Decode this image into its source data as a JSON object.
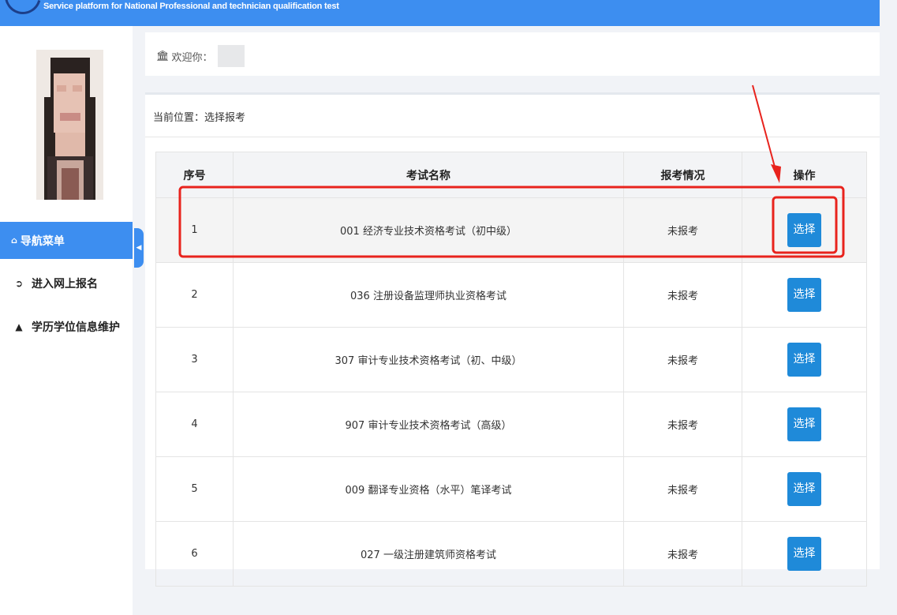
{
  "header": {
    "subtitle": "Service platform for National Professional and technician qualification test",
    "brand_color": "#3d8ef0"
  },
  "sidebar": {
    "nav_title": "导航菜单",
    "nav_icon": "home-icon",
    "items": [
      {
        "label": "进入网上报名",
        "icon": "sign-in-icon"
      },
      {
        "label": "学历学位信息维护",
        "icon": "graduation-cap-icon"
      }
    ]
  },
  "welcome": {
    "icon": "bank-icon",
    "text": "欢迎你："
  },
  "breadcrumb": "当前位置：选择报考",
  "table": {
    "headers": [
      "序号",
      "考试名称",
      "报考情况",
      "操作"
    ],
    "rows": [
      {
        "index": "1",
        "name": "001 经济专业技术资格考试（初中级）",
        "status": "未报考",
        "action": "选择"
      },
      {
        "index": "2",
        "name": "036 注册设备监理师执业资格考试",
        "status": "未报考",
        "action": "选择"
      },
      {
        "index": "3",
        "name": "307 审计专业技术资格考试（初、中级）",
        "status": "未报考",
        "action": "选择"
      },
      {
        "index": "4",
        "name": "907 审计专业技术资格考试（高级）",
        "status": "未报考",
        "action": "选择"
      },
      {
        "index": "5",
        "name": "009 翻译专业资格（水平）笔译考试",
        "status": "未报考",
        "action": "选择"
      },
      {
        "index": "6",
        "name": "027 一级注册建筑师资格考试",
        "status": "未报考",
        "action": "选择"
      }
    ]
  },
  "colors": {
    "button": "#1f8ad9",
    "annotation": "#e8231d"
  }
}
